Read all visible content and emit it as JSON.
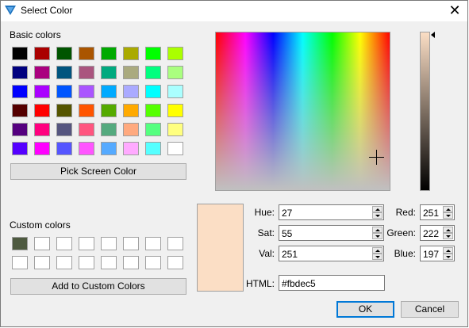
{
  "window": {
    "title": "Select Color",
    "close_symbol": "✕"
  },
  "basic_colors": {
    "label": "Basic colors",
    "swatches": [
      "#000000",
      "#aa0000",
      "#005500",
      "#aa5500",
      "#00aa00",
      "#aaaa00",
      "#00ff00",
      "#aaff00",
      "#00007f",
      "#aa007f",
      "#00557f",
      "#aa557f",
      "#00aa7f",
      "#aaaa7f",
      "#00ff7f",
      "#aaff7f",
      "#0000ff",
      "#aa00ff",
      "#0055ff",
      "#aa55ff",
      "#00aaff",
      "#aaaaff",
      "#00ffff",
      "#aaffff",
      "#550000",
      "#ff0000",
      "#555500",
      "#ff5500",
      "#55aa00",
      "#ffaa00",
      "#55ff00",
      "#ffff00",
      "#55007f",
      "#ff007f",
      "#55557f",
      "#ff557f",
      "#55aa7f",
      "#ffaa7f",
      "#55ff7f",
      "#ffff7f",
      "#5500ff",
      "#ff00ff",
      "#5555ff",
      "#ff55ff",
      "#55aaff",
      "#ffaaff",
      "#55ffff",
      "#ffffff"
    ]
  },
  "pick_screen_label": "Pick Screen Color",
  "custom_colors": {
    "label": "Custom colors",
    "swatches": [
      "#4e5a40",
      "#ffffff",
      "#ffffff",
      "#ffffff",
      "#ffffff",
      "#ffffff",
      "#ffffff",
      "#ffffff",
      "#ffffff",
      "#ffffff",
      "#ffffff",
      "#ffffff",
      "#ffffff",
      "#ffffff",
      "#ffffff",
      "#ffffff"
    ]
  },
  "add_custom_label": "Add to Custom Colors",
  "current_color": "#fbdec5",
  "fields": {
    "hue": {
      "label": "Hue:",
      "value": "27"
    },
    "sat": {
      "label": "Sat:",
      "value": "55"
    },
    "val": {
      "label": "Val:",
      "value": "251"
    },
    "red": {
      "label": "Red:",
      "value": "251"
    },
    "green": {
      "label": "Green:",
      "value": "222"
    },
    "blue": {
      "label": "Blue:",
      "value": "197"
    },
    "html": {
      "label": "HTML:",
      "value": "#fbdec5"
    }
  },
  "buttons": {
    "ok": "OK",
    "cancel": "Cancel"
  }
}
